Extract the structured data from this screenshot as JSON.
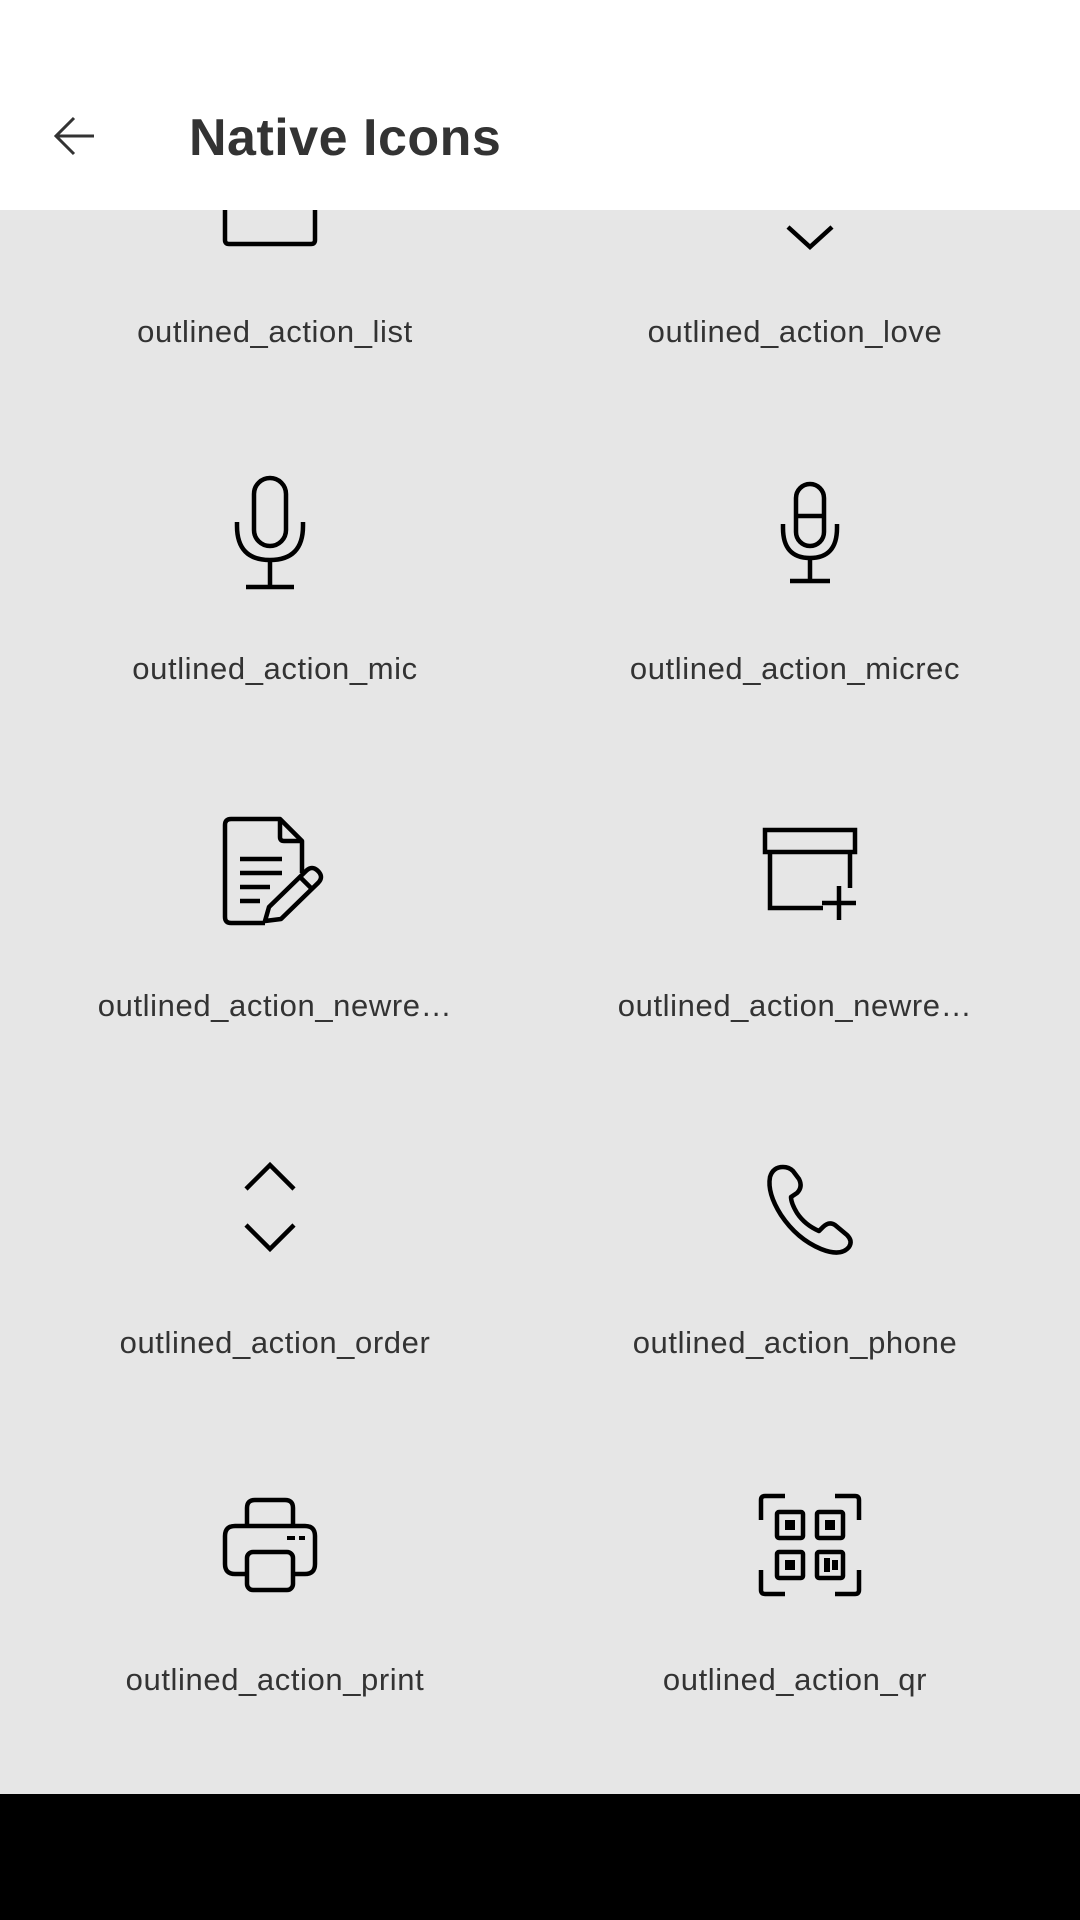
{
  "header": {
    "title": "Native Icons",
    "back_icon": "arrow-left-icon"
  },
  "grid": {
    "items": [
      {
        "label": "outlined_action_list",
        "icon": "list-icon"
      },
      {
        "label": "outlined_action_love",
        "icon": "love-icon"
      },
      {
        "label": "outlined_action_mic",
        "icon": "mic-icon"
      },
      {
        "label": "outlined_action_micrec",
        "icon": "mic-record-icon"
      },
      {
        "label": "outlined_action_newre…",
        "icon": "new-document-icon"
      },
      {
        "label": "outlined_action_newre…",
        "icon": "new-box-icon"
      },
      {
        "label": "outlined_action_order",
        "icon": "order-icon"
      },
      {
        "label": "outlined_action_phone",
        "icon": "phone-icon"
      },
      {
        "label": "outlined_action_print",
        "icon": "printer-icon"
      },
      {
        "label": "outlined_action_qr",
        "icon": "qr-code-icon"
      }
    ]
  },
  "colors": {
    "background": "#e6e6e6",
    "header": "#ffffff",
    "text": "#333333",
    "system_bar": "#000000"
  }
}
